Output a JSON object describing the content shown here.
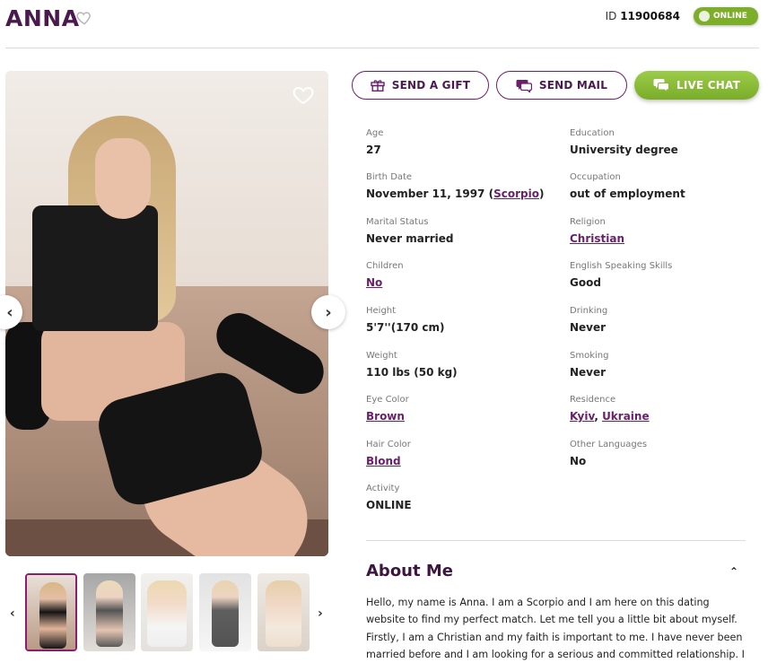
{
  "profile": {
    "name": "ANNA",
    "id_label": "ID",
    "id_value": "11900684",
    "status_badge": "ONLINE"
  },
  "actions": {
    "gift": "SEND A GIFT",
    "mail": "SEND MAIL",
    "chat": "LIVE CHAT"
  },
  "details_left": [
    {
      "label": "Age",
      "value": "27"
    },
    {
      "label": "Birth Date",
      "value": "November 11, 1997 (",
      "link": "Scorpio",
      "suffix": ")"
    },
    {
      "label": "Marital Status",
      "value": "Never married"
    },
    {
      "label": "Children",
      "link": "No"
    },
    {
      "label": "Height",
      "value": "5'7''(170 cm)"
    },
    {
      "label": "Weight",
      "value": "110 lbs (50 kg)"
    },
    {
      "label": "Eye Color",
      "link": "Brown"
    },
    {
      "label": "Hair Color",
      "link": "Blond"
    },
    {
      "label": "Activity",
      "value": "ONLINE"
    }
  ],
  "details_right": [
    {
      "label": "Education",
      "value": "University degree"
    },
    {
      "label": "Occupation",
      "value": "out of employment"
    },
    {
      "label": "Religion",
      "link": "Christian"
    },
    {
      "label": "English Speaking Skills",
      "value": "Good"
    },
    {
      "label": "Drinking",
      "value": "Never"
    },
    {
      "label": "Smoking",
      "value": "Never"
    },
    {
      "label": "Residence",
      "link": "Kyiv",
      "sep": ", ",
      "link2": "Ukraine"
    },
    {
      "label": "Other Languages",
      "value": "No"
    }
  ],
  "about": {
    "title": "About Me",
    "text": "Hello, my name is Anna. I am a Scorpio and I am here on this dating website to find my perfect match. Let me tell you a little bit about myself. Firstly, I am a Christian and my faith is important to me. I have never been married before and I am looking for a serious and committed relationship. I"
  },
  "icons": {
    "favorite": "heart-outline-icon",
    "gift": "gift-icon",
    "mail": "mail-chat-icon",
    "chat": "chat-bubbles-icon",
    "prev": "chevron-left-icon",
    "next": "chevron-right-icon",
    "collapse": "chevron-up-icon"
  },
  "colors": {
    "brand": "#4a1a4e",
    "link": "#6a1f6b",
    "online": "#7cae2a"
  }
}
